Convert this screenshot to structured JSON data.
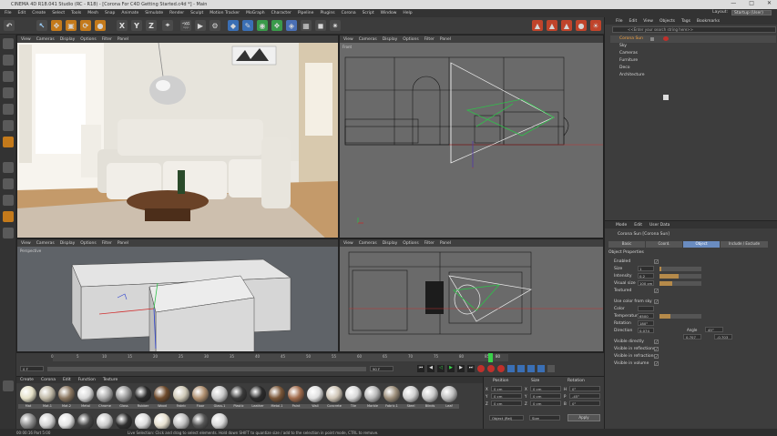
{
  "window": {
    "title": "CINEMA 4D R18.041 Studio (RC - R18) - [Corona For C4D Getting Started.c4d *] - Main",
    "controls": [
      "—",
      "□",
      "✕"
    ]
  },
  "menubar": {
    "items": [
      "File",
      "Edit",
      "Create",
      "Select",
      "Tools",
      "Mesh",
      "Snap",
      "Animate",
      "Simulate",
      "Render",
      "Sculpt",
      "Motion Tracker",
      "MoGraph",
      "Character",
      "Pipeline",
      "Plugins",
      "Corona",
      "Script",
      "Window",
      "Help"
    ],
    "layout_label": "Layout:",
    "layout_value": "Startup (User)"
  },
  "toolbar": {
    "axis_labels": [
      "X",
      "Y",
      "Z"
    ]
  },
  "viewports": {
    "menu": [
      "View",
      "Cameras",
      "Display",
      "Options",
      "Filter",
      "Panel"
    ],
    "tl": {
      "tag": ""
    },
    "tr": {
      "tag": "Front"
    },
    "bl": {
      "tag": "Perspective"
    },
    "br": {
      "tag": ""
    }
  },
  "timeline": {
    "ticks": [
      "0",
      "5",
      "10",
      "15",
      "20",
      "25",
      "30",
      "35",
      "40",
      "45",
      "50",
      "55",
      "60",
      "65",
      "70",
      "75",
      "80",
      "85",
      "90"
    ],
    "start": "0 F",
    "end": "90 F",
    "playhead_frame": "80"
  },
  "materials": {
    "menu": [
      "Create",
      "Corona",
      "Edit",
      "Function",
      "Texture"
    ],
    "labels": [
      "Mat",
      "Mat.1",
      "Mat.2",
      "Metal",
      "Chrome",
      "Glass",
      "Rubber",
      "Wood",
      "Fabric",
      "Floor",
      "Glass.1",
      "Plastic",
      "Leather",
      "Metal.1",
      "Paint",
      "Wall",
      "Concrete",
      "Tile",
      "Marble",
      "Fabric.1",
      "Steel",
      "Blinds",
      "Leaf",
      "Plant"
    ],
    "colors": [
      "#e5e1c8",
      "#bfb8a6",
      "#8a7660",
      "#d9d9d9",
      "#aaaaaa",
      "#9a9a9a",
      "#2a2a2a",
      "#6f4b2c",
      "#cfc9b7",
      "#b09070",
      "#c8c8c8",
      "#3a3a3a",
      "#2b2b2b",
      "#7a5638",
      "#a26c4d",
      "#e0e0e0",
      "#cfc5b6",
      "#d8d8d8",
      "#b8b8b8",
      "#9c8e7a",
      "#d0d0d0",
      "#c9c9c9",
      "#bdbdbd",
      "#8c8c8c",
      "#d3d3d3",
      "#e3e3e3",
      "#444444",
      "#cccccc",
      "#2e2e2e",
      "#dcdcdc",
      "#e8e1d0",
      "#c0c0c0",
      "#555555",
      "#d8d8d8"
    ]
  },
  "coordinates": {
    "headers": [
      "Position",
      "Size",
      "Rotation"
    ],
    "rows": [
      [
        "X",
        "0 cm",
        "X",
        "0 cm",
        "H",
        "0°"
      ],
      [
        "Y",
        "0 cm",
        "Y",
        "0 cm",
        "P",
        "-45°"
      ],
      [
        "Z",
        "0 cm",
        "Z",
        "0 cm",
        "B",
        "0°"
      ]
    ],
    "mode": "Object (Rel)",
    "size_mode": "Size",
    "apply": "Apply"
  },
  "object_manager": {
    "menu": [
      "File",
      "Edit",
      "View",
      "Objects",
      "Tags",
      "Bookmarks"
    ],
    "search": "<<Enter your search string here>>",
    "objects": [
      "Corona Sun",
      "Sky",
      "Cameras",
      "Furniture",
      "Deco",
      "Architecture"
    ]
  },
  "attributes": {
    "menu": [
      "Mode",
      "Edit",
      "User Data"
    ],
    "title": "Corona Sun [Corona Sun]",
    "tabs": [
      "Basic",
      "Coord.",
      "Object",
      "Include / Exclude"
    ],
    "section": "Object Properties",
    "fields": [
      {
        "label": "Enabled",
        "value": "✓",
        "kind": "check"
      },
      {
        "label": "Size",
        "value": "1",
        "kind": "slider",
        "level": 0.05
      },
      {
        "label": "Intensity",
        "value": "0.2",
        "kind": "slider",
        "level": 0.45
      },
      {
        "label": "Visual size",
        "value": "100 cm",
        "kind": "slider",
        "level": 0.3
      },
      {
        "label": "Textured",
        "value": "✓",
        "kind": "check"
      },
      {
        "label": "Use color from sky",
        "value": "✓",
        "kind": "check"
      },
      {
        "label": "Color",
        "value": "",
        "kind": "text"
      },
      {
        "label": "Temperature",
        "value": "6500",
        "kind": "slider",
        "level": 0.25
      },
      {
        "label": "Rotation",
        "value": "180°",
        "kind": "text"
      },
      {
        "label": "Direction",
        "value": "0.074",
        "kind": "text"
      },
      {
        "label": "Visible directly",
        "value": "✓",
        "kind": "check"
      },
      {
        "label": "Visible in reflections",
        "value": "✓",
        "kind": "check"
      },
      {
        "label": "Visible in refractions",
        "value": "✓",
        "kind": "check"
      },
      {
        "label": "Visible in volume",
        "value": "✓",
        "kind": "check"
      }
    ],
    "angle_label": "Angle",
    "angle_value": "45°",
    "dir_y": "0.707",
    "dir_z": "-0.703"
  },
  "status": {
    "time": "00:00:16 Part 5:00",
    "hint": "Live Selection: Click and drag to select elements. Hold down SHIFT to quantize size / add to the selection in point mode, CTRL to remove."
  }
}
